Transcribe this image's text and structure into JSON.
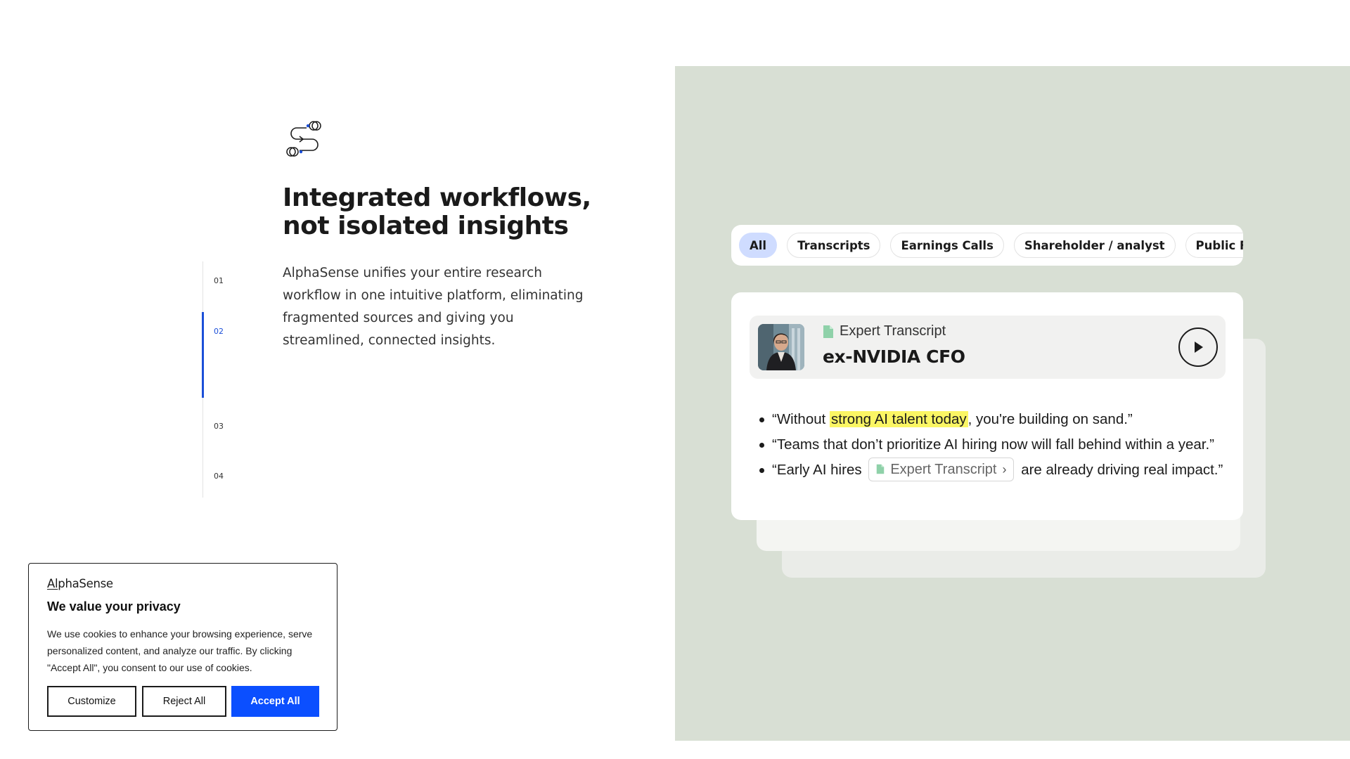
{
  "hero": {
    "icon": "workflow-icon",
    "headline_line1": "Integrated workflows,",
    "headline_line2": "not isolated insights",
    "body": "AlphaSense unifies your entire research workflow in one intuitive platform, eliminating fragmented sources and giving you streamlined, connected insights."
  },
  "steps": {
    "items": [
      "01",
      "02",
      "03",
      "04"
    ],
    "active": "02",
    "accent_color": "#1b4fd8"
  },
  "filters": {
    "chips": [
      "All",
      "Transcripts",
      "Earnings Calls",
      "Shareholder / analyst",
      "Public Fillings"
    ],
    "active": "All",
    "active_color": "#cfdcff"
  },
  "card": {
    "doc_type": "Expert Transcript",
    "title": "ex-NVIDIA CFO",
    "avatar": "avatar-photo",
    "play_icon": "play-icon",
    "quotes": [
      {
        "pre": "“Without ",
        "highlight": "strong AI talent today",
        "post": ", you're building on sand.”"
      },
      {
        "text": "“Teams that don’t prioritize AI hiring now will fall behind within a year.”"
      },
      {
        "pre": "“Early AI hires",
        "pill": "Expert Transcript",
        "post": "are already driving real impact.”"
      }
    ],
    "highlight_color": "#fbf664"
  },
  "panel": {
    "background": "#d8dfd4"
  },
  "cookie": {
    "logo": "AlphaSense",
    "title": "We value your privacy",
    "text": "We use cookies to enhance your browsing experience, serve personalized content, and analyze our traffic. By clicking \"Accept All\", you consent to our use of cookies.",
    "customize_label": "Customize",
    "reject_label": "Reject All",
    "accept_label": "Accept All",
    "accept_color": "#0b4fff"
  }
}
